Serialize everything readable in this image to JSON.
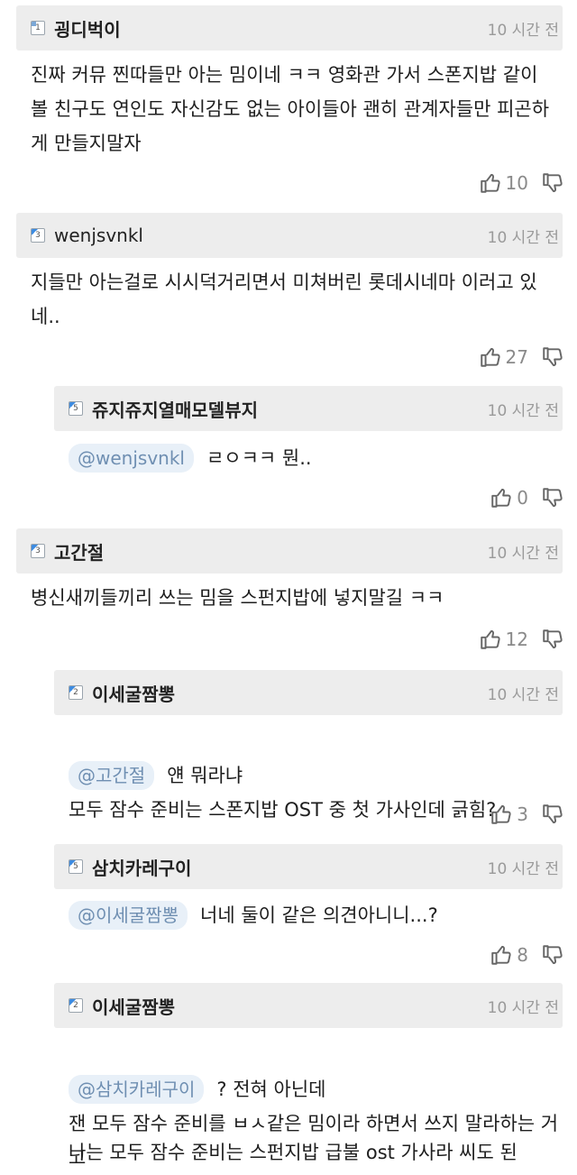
{
  "comments": [
    {
      "level": "1",
      "nickname": "굉디벅이",
      "time": "10 시간 전",
      "mention": "",
      "text": "진짜 커뮤 찐따들만 아는 밈이네 ㅋㅋ 영화관 가서 스폰지밥 같이 볼 친구도 연인도 자신감도 없는 아이들아 괜히 관계자들만 피곤하게 만들지말자",
      "likes": "10"
    },
    {
      "level": "3",
      "nickname": "wenjsvnkl",
      "time": "10 시간 전",
      "mention": "",
      "text": "지들만 아는걸로 시시덕거리면서 미쳐버린 롯데시네마 이러고 있네..",
      "likes": "27"
    },
    {
      "level": "5",
      "nickname": "쥬지쥬지열매모델뷰지",
      "time": "10 시간 전",
      "mention": "@wenjsvnkl",
      "text": "ㄹㅇㅋㅋ 뭔..",
      "likes": "0"
    },
    {
      "level": "3",
      "nickname": "고간절",
      "time": "10 시간 전",
      "mention": "",
      "text": "병신새끼들끼리 쓰는 밈을 스펀지밥에 넣지말길 ㅋㅋ",
      "likes": "12"
    },
    {
      "level": "2",
      "nickname": "이세굴짬뽕",
      "time": "10 시간 전",
      "mention": "@고간절",
      "text": "얜 뭐라냐\n모두 잠수 준비는 스폰지밥 OST 중 첫 가사인데 긁힘?",
      "likes": "3"
    },
    {
      "level": "5",
      "nickname": "삼치카레구이",
      "time": "10 시간 전",
      "mention": "@이세굴짬뽕",
      "text": "너네 둘이 같은 의견아니니...?",
      "likes": "8"
    },
    {
      "level": "2",
      "nickname": "이세굴짬뽕",
      "time": "10 시간 전",
      "mention": "@삼치카레구이",
      "text": "? 전혀 아닌데\n잰 모두 잠수 준비를 ㅂㅅ같은 밈이라 하면서 쓰지 말라하는 거고",
      "likes": ""
    }
  ],
  "truncated_line": "나는 모두 잠수 준비는 스펀지밥 급불 ost 가사라 씨도 된",
  "icons": {
    "like": "thumbs-up-icon",
    "dislike": "thumbs-down-icon"
  },
  "colors": {
    "header_bg": "#ededed",
    "mention_bg": "#e8f0f8",
    "mention_text": "#6f8fb2",
    "muted": "#9a9a9a"
  }
}
